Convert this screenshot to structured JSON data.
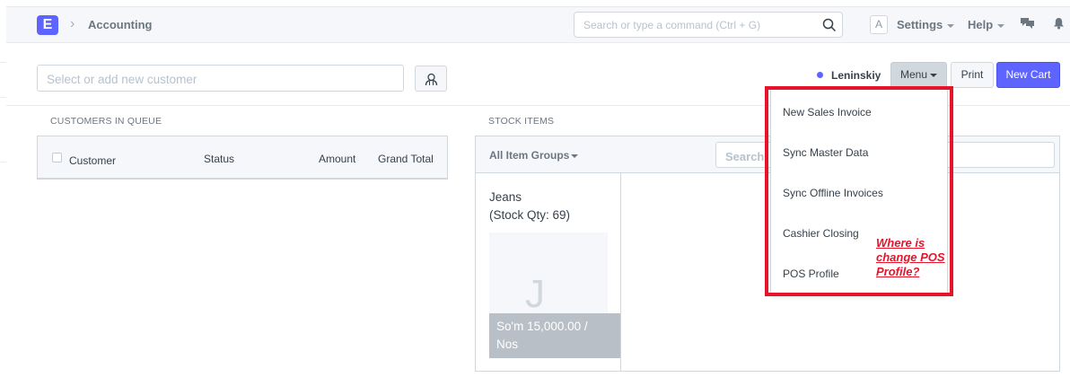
{
  "navbar": {
    "logo_letter": "E",
    "breadcrumb": "Accounting",
    "search_placeholder": "Search or type a command (Ctrl + G)",
    "avatar_letter": "A",
    "settings_label": "Settings",
    "help_label": "Help"
  },
  "pos": {
    "customer_placeholder": "Select or add new customer",
    "store_name": "Leninskiy",
    "menu_label": "Menu",
    "print_label": "Print",
    "new_cart_label": "New Cart"
  },
  "queue": {
    "title": "CUSTOMERS IN QUEUE",
    "columns": [
      "Customer",
      "Status",
      "Amount",
      "Grand Total"
    ]
  },
  "stock": {
    "title": "STOCK ITEMS",
    "group_filter": "All Item Groups",
    "search_placeholder": "Search",
    "items": [
      {
        "name": "Jeans",
        "qty_text": "(Stock Qty: 69)",
        "letter": "J",
        "price": "So'm 15,000.00 /",
        "unit": "Nos"
      }
    ]
  },
  "menu_dropdown": {
    "items": [
      "New Sales Invoice",
      "Sync Master Data",
      "Sync Offline Invoices",
      "Cashier Closing",
      "POS Profile"
    ]
  },
  "annotation": {
    "text": "Where is change POS Profile?",
    "color": "#e5142b"
  },
  "colors": {
    "primary": "#5e64ff",
    "highlight": "#e5142b"
  }
}
